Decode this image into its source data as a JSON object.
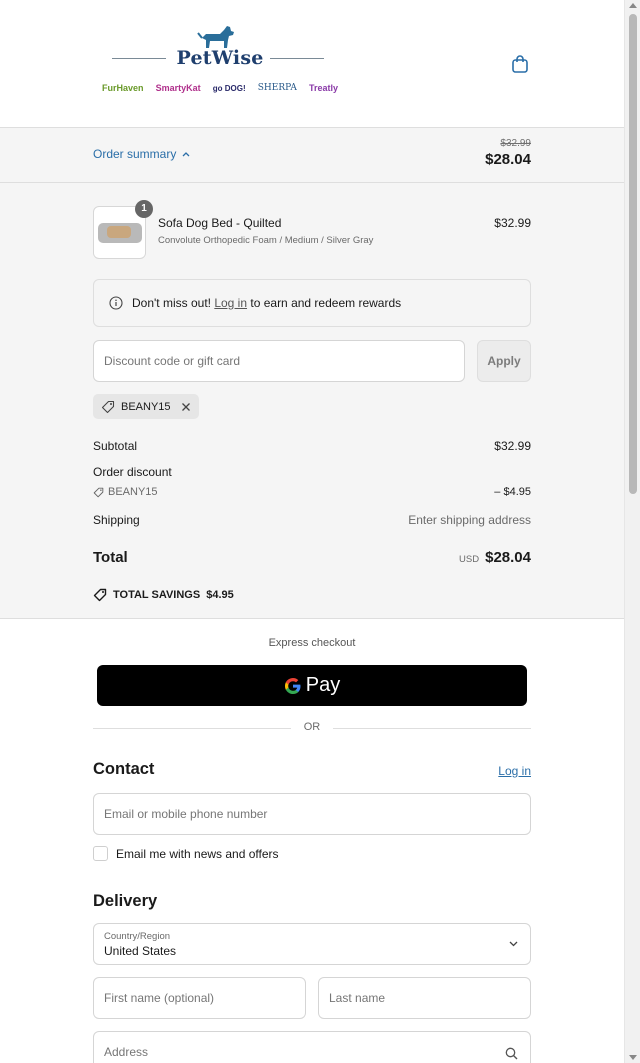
{
  "header": {
    "brand": "PetWise",
    "sub_brands": [
      {
        "name": "FurHaven",
        "color": "#6a9a2a"
      },
      {
        "name": "SmartyKat",
        "color": "#b0308c"
      },
      {
        "name": "go DOG!",
        "color": "#2a2a6a"
      },
      {
        "name": "SHERPA",
        "color": "#2a5a8a"
      },
      {
        "name": "Treatly",
        "color": "#8a3aa8"
      }
    ],
    "cart_icon": "shopping-bag-icon"
  },
  "order_summary": {
    "toggle_label": "Order summary",
    "original_price": "$32.99",
    "current_price": "$28.04"
  },
  "cart": {
    "item": {
      "quantity": "1",
      "name": "Sofa Dog Bed - Quilted",
      "variant": "Convolute Orthopedic Foam / Medium / Silver Gray",
      "price": "$32.99"
    },
    "notice": {
      "prefix": "Don't miss out!",
      "link": "Log in",
      "suffix": "to earn and redeem rewards"
    },
    "discount": {
      "placeholder": "Discount code or gift card",
      "apply_label": "Apply",
      "applied_code": "BEANY15"
    },
    "totals": {
      "subtotal_label": "Subtotal",
      "subtotal_value": "$32.99",
      "order_discount_label": "Order discount",
      "discount_code": "BEANY15",
      "discount_value": "– $4.95",
      "shipping_label": "Shipping",
      "shipping_value": "Enter shipping address",
      "total_label": "Total",
      "currency": "USD",
      "total_value": "$28.04",
      "savings_label": "TOTAL SAVINGS",
      "savings_value": "$4.95"
    }
  },
  "express": {
    "title": "Express checkout",
    "gpay_label": "Pay",
    "or_label": "OR"
  },
  "contact": {
    "title": "Contact",
    "login_link": "Log in",
    "email_placeholder": "Email or mobile phone number",
    "newsletter_label": "Email me with news and offers"
  },
  "delivery": {
    "title": "Delivery",
    "country_label": "Country/Region",
    "country_value": "United States",
    "first_name_placeholder": "First name (optional)",
    "last_name_placeholder": "Last name",
    "address_placeholder": "Address"
  },
  "colors": {
    "accent": "#2a6ea8",
    "panel_bg": "#f5f5f5",
    "brand": "#1f3f6e"
  }
}
